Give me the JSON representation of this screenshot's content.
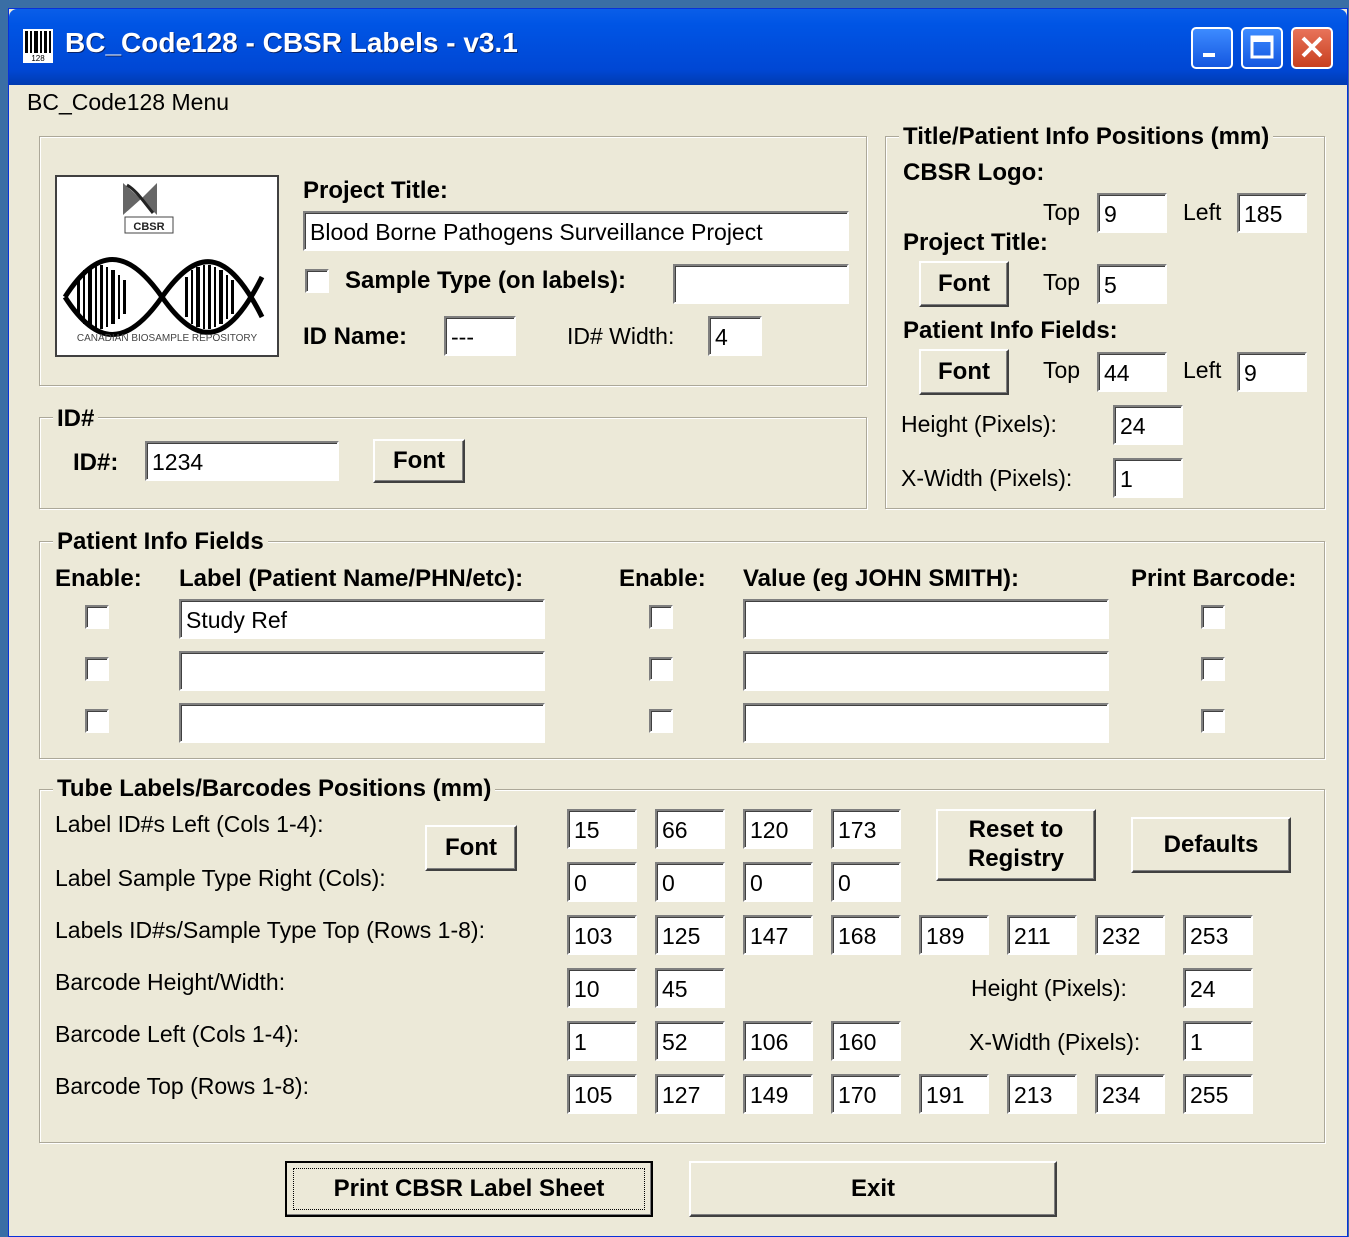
{
  "window": {
    "title": "BC_Code128 - CBSR Labels - v3.1",
    "menu": "BC_Code128 Menu"
  },
  "project": {
    "logo_text_top": "CBSR",
    "logo_text_bottom": "CANADIAN BIOSAMPLE REPOSITORY",
    "title_label": "Project Title:",
    "title_value": "Blood Borne Pathogens Surveillance Project",
    "sample_type_label": "Sample Type (on labels):",
    "sample_type_value": "",
    "id_name_label": "ID Name:",
    "id_name_value": "---",
    "id_width_label": "ID# Width:",
    "id_width_value": "4"
  },
  "idgroup": {
    "legend": "ID#",
    "label": "ID#:",
    "value": "1234",
    "font_btn": "Font"
  },
  "positions": {
    "legend": "Title/Patient Info Positions (mm)",
    "logo_label": "CBSR Logo:",
    "top_label": "Top",
    "left_label": "Left",
    "logo_top": "9",
    "logo_left": "185",
    "project_title_label": "Project Title:",
    "font_btn": "Font",
    "title_top": "5",
    "patient_label": "Patient Info Fields:",
    "patient_top": "44",
    "patient_left": "9",
    "height_label": "Height (Pixels):",
    "height_value": "24",
    "xwidth_label": "X-Width (Pixels):",
    "xwidth_value": "1"
  },
  "patient": {
    "legend": "Patient Info Fields",
    "col_enable1": "Enable:",
    "col_label": "Label (Patient Name/PHN/etc):",
    "col_enable2": "Enable:",
    "col_value": "Value (eg JOHN SMITH):",
    "col_barcode": "Print Barcode:",
    "rows": [
      {
        "label": "Study Ref",
        "value": ""
      },
      {
        "label": "",
        "value": ""
      },
      {
        "label": "",
        "value": ""
      }
    ]
  },
  "tube": {
    "legend": "Tube Labels/Barcodes Positions (mm)",
    "font_btn": "Font",
    "reset_btn": "Reset to Registry",
    "defaults_btn": "Defaults",
    "row_labels": {
      "id_left": "Label ID#s Left (Cols 1-4):",
      "sample_right": "Label Sample Type Right (Cols):",
      "top": "Labels ID#s/Sample Type Top (Rows 1-8):",
      "bc_hw": "Barcode Height/Width:",
      "bc_left": "Barcode Left (Cols 1-4):",
      "bc_top": "Barcode Top (Rows 1-8):"
    },
    "id_left": [
      "15",
      "66",
      "120",
      "173"
    ],
    "sample_right": [
      "0",
      "0",
      "0",
      "0"
    ],
    "top": [
      "103",
      "125",
      "147",
      "168",
      "189",
      "211",
      "232",
      "253"
    ],
    "bc_hw": [
      "10",
      "45"
    ],
    "height_label": "Height (Pixels):",
    "height_value": "24",
    "bc_left": [
      "1",
      "52",
      "106",
      "160"
    ],
    "xwidth_label": "X-Width (Pixels):",
    "xwidth_value": "1",
    "bc_top": [
      "105",
      "127",
      "149",
      "170",
      "191",
      "213",
      "234",
      "255"
    ]
  },
  "footer": {
    "print_btn": "Print CBSR Label Sheet",
    "exit_btn": "Exit"
  }
}
